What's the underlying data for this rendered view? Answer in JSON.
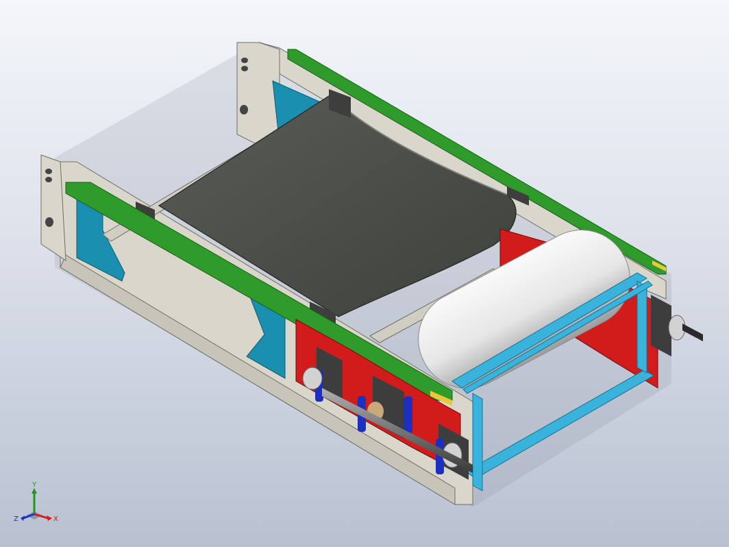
{
  "viewport": {
    "background_top": "#f4f6fa",
    "background_bottom": "#b9c1d1"
  },
  "model": {
    "colors": {
      "frame_gray": "#d9d6cc",
      "frame_shadow": "#a9a69c",
      "rail_green": "#2e9b2a",
      "belt_dark": "#4c4e49",
      "bracket_teal": "#1b8fb0",
      "plate_red": "#d21c1c",
      "cage_cyan": "#3ab3dc",
      "bearing_blue": "#1d2fbf",
      "roller_white": "#ececec",
      "accent_yellow": "#e7c93a"
    }
  },
  "triad": {
    "x_label": "X",
    "y_label": "Y",
    "z_label": "Z",
    "x_color": "#d41c1c",
    "y_color": "#1a9a1a",
    "z_color": "#1a33c8"
  }
}
